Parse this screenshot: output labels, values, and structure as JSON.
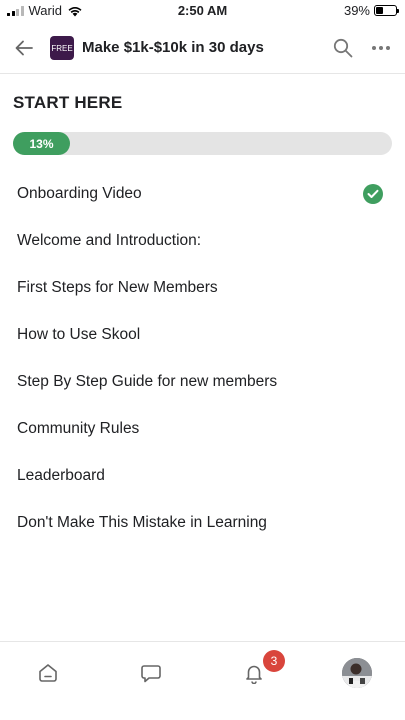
{
  "status_bar": {
    "carrier": "Warid",
    "time": "2:50 AM",
    "battery": "39%",
    "battery_level": 0.39
  },
  "header": {
    "badge_label": "FREE",
    "title": "Make $1k-$10k in 30 days",
    "icons": [
      "back-arrow-icon",
      "search-icon",
      "more-icon"
    ]
  },
  "section": {
    "title": "START HERE",
    "progress_label": "13%",
    "progress_value": 0.13
  },
  "lessons": [
    {
      "label": "Onboarding Video",
      "completed": true
    },
    {
      "label": "Welcome and Introduction:",
      "completed": false
    },
    {
      "label": "First Steps for New Members",
      "completed": false
    },
    {
      "label": "How to Use Skool",
      "completed": false
    },
    {
      "label": "Step By Step Guide for new members",
      "completed": false
    },
    {
      "label": "Community Rules",
      "completed": false
    },
    {
      "label": "Leaderboard",
      "completed": false
    },
    {
      "label": "Don't Make This Mistake in Learning",
      "completed": false
    }
  ],
  "bottom_nav": {
    "notification_count": "3",
    "icons": [
      "home-icon",
      "chat-icon",
      "bell-icon",
      "avatar"
    ]
  },
  "colors": {
    "accent_green": "#3f9e5f",
    "badge_red": "#d9453c",
    "header_badge_bg": "#3d1a4a"
  }
}
